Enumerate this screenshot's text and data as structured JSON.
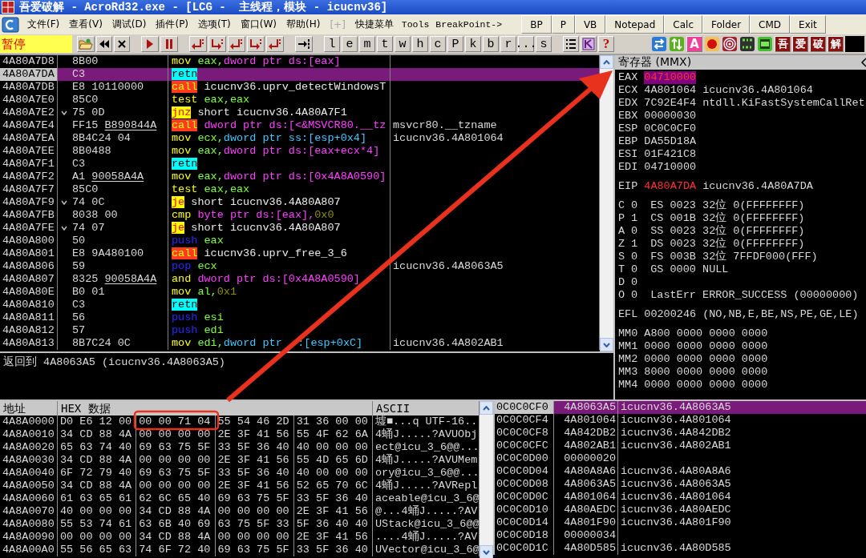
{
  "window": {
    "title": "吾爱破解 - AcroRd32.exe - [LCG -  主线程，模块 - icucnv36]"
  },
  "menu": [
    {
      "label": "文件(F)",
      "kind": "menu",
      "disabled": false
    },
    {
      "label": "查看(V)",
      "kind": "menu",
      "disabled": false
    },
    {
      "label": "调试(D)",
      "kind": "menu",
      "disabled": false
    },
    {
      "label": "插件(P)",
      "kind": "menu",
      "disabled": false
    },
    {
      "label": "选项(T)",
      "kind": "menu",
      "disabled": false
    },
    {
      "label": "窗口(W)",
      "kind": "menu",
      "disabled": false
    },
    {
      "label": "帮助(H)",
      "kind": "menu",
      "disabled": false
    },
    {
      "label": "[+]",
      "kind": "menu",
      "disabled": true
    },
    {
      "label": "快捷菜单",
      "kind": "menu",
      "disabled": false
    },
    {
      "label": "Tools",
      "kind": "script",
      "disabled": false
    },
    {
      "label": "BreakPoint->",
      "kind": "script",
      "disabled": false
    }
  ],
  "quick_buttons": [
    "BP",
    "P",
    "VB",
    "Notepad",
    "Calc",
    "Folder",
    "CMD",
    "Exit"
  ],
  "toolbar": {
    "status": "暂停",
    "letter_buttons": [
      "l",
      "e",
      "m",
      "t",
      "w",
      "h",
      "c",
      "P",
      "k",
      "b",
      "r",
      "...",
      "s"
    ],
    "help": "?",
    "ascii_button": "A",
    "brand_buttons": [
      "吾",
      "爱",
      "破",
      "解"
    ]
  },
  "disasm": {
    "rows": [
      {
        "address": "4A80A7D8",
        "jump": false,
        "selected": false,
        "hex": [
          {
            "text": "8B00",
            "underlined": false
          }
        ],
        "mnemonic": {
          "text": "mov",
          "kind": "move"
        },
        "operands": [
          {
            "text": "eax,",
            "kind": "reg"
          },
          {
            "text": "dword ptr ds:[eax]",
            "kind": "mem"
          }
        ]
      },
      {
        "address": "4A80A7DA",
        "jump": false,
        "selected": true,
        "hex": [
          {
            "text": "C3",
            "underlined": false
          }
        ],
        "mnemonic": {
          "text": "retn",
          "kind": "ret"
        },
        "operands": []
      },
      {
        "address": "4A80A7DB",
        "jump": false,
        "selected": false,
        "hex": [
          {
            "text": "E8",
            "underlined": false
          },
          {
            "text": "10110000",
            "underlined": false
          }
        ],
        "mnemonic": {
          "text": "call",
          "kind": "call"
        },
        "operands": [
          {
            "text": "icucnv36.uprv_detectWindowsT",
            "kind": "plain"
          }
        ]
      },
      {
        "address": "4A80A7E0",
        "jump": false,
        "selected": false,
        "hex": [
          {
            "text": "85C0",
            "underlined": false
          }
        ],
        "mnemonic": {
          "text": "test",
          "kind": "move"
        },
        "operands": [
          {
            "text": "eax,eax",
            "kind": "reg"
          }
        ]
      },
      {
        "address": "4A80A7E2",
        "jump": true,
        "selected": false,
        "hex": [
          {
            "text": "75",
            "underlined": false
          },
          {
            "text": "0D",
            "underlined": false
          }
        ],
        "mnemonic": {
          "text": "jnz",
          "kind": "jump"
        },
        "operands": [
          {
            "text": "short icucnv36.4A80A7F1",
            "kind": "plain"
          }
        ]
      },
      {
        "address": "4A80A7E4",
        "jump": false,
        "selected": false,
        "hex": [
          {
            "text": "FF15",
            "underlined": false
          },
          {
            "text": "B890844A",
            "underlined": true
          }
        ],
        "mnemonic": {
          "text": "call",
          "kind": "call"
        },
        "operands": [
          {
            "text": "dword ptr ds:[<&MSVCR80.__tz",
            "kind": "mem"
          }
        ],
        "comment": "msvcr80.__tzname"
      },
      {
        "address": "4A80A7EA",
        "jump": false,
        "selected": false,
        "hex": [
          {
            "text": "8B4C24",
            "underlined": false
          },
          {
            "text": "04",
            "underlined": false
          }
        ],
        "mnemonic": {
          "text": "mov",
          "kind": "move"
        },
        "operands": [
          {
            "text": "ecx,",
            "kind": "reg"
          },
          {
            "text": "dword ptr ss:[esp+0x4]",
            "kind": "stack_mem"
          }
        ],
        "comment": "icucnv36.4A801064"
      },
      {
        "address": "4A80A7EE",
        "jump": false,
        "selected": false,
        "hex": [
          {
            "text": "8B0488",
            "underlined": false
          }
        ],
        "mnemonic": {
          "text": "mov",
          "kind": "move"
        },
        "operands": [
          {
            "text": "eax,",
            "kind": "reg"
          },
          {
            "text": "dword ptr ds:[eax+ecx*4]",
            "kind": "mem"
          }
        ]
      },
      {
        "address": "4A80A7F1",
        "jump": false,
        "selected": false,
        "hex": [
          {
            "text": "C3",
            "underlined": false
          }
        ],
        "mnemonic": {
          "text": "retn",
          "kind": "ret"
        },
        "operands": []
      },
      {
        "address": "4A80A7F2",
        "jump": false,
        "selected": false,
        "hex": [
          {
            "text": "A1",
            "underlined": false
          },
          {
            "text": "90058A4A",
            "underlined": true
          }
        ],
        "mnemonic": {
          "text": "mov",
          "kind": "move"
        },
        "operands": [
          {
            "text": "eax,",
            "kind": "reg"
          },
          {
            "text": "dword ptr ds:[0x4A8A0590]",
            "kind": "mem"
          }
        ]
      },
      {
        "address": "4A80A7F7",
        "jump": false,
        "selected": false,
        "hex": [
          {
            "text": "85C0",
            "underlined": false
          }
        ],
        "mnemonic": {
          "text": "test",
          "kind": "move"
        },
        "operands": [
          {
            "text": "eax,eax",
            "kind": "reg"
          }
        ]
      },
      {
        "address": "4A80A7F9",
        "jump": true,
        "selected": false,
        "hex": [
          {
            "text": "74",
            "underlined": false
          },
          {
            "text": "0C",
            "underlined": false
          }
        ],
        "mnemonic": {
          "text": "je",
          "kind": "jump"
        },
        "operands": [
          {
            "text": "short icucnv36.4A80A807",
            "kind": "plain"
          }
        ]
      },
      {
        "address": "4A80A7FB",
        "jump": false,
        "selected": false,
        "hex": [
          {
            "text": "8038",
            "underlined": false
          },
          {
            "text": "00",
            "underlined": false
          }
        ],
        "mnemonic": {
          "text": "cmp",
          "kind": "move"
        },
        "operands": [
          {
            "text": "byte ptr ds:[eax],",
            "kind": "mem"
          },
          {
            "text": "0x0",
            "kind": "imm"
          }
        ]
      },
      {
        "address": "4A80A7FE",
        "jump": true,
        "selected": false,
        "hex": [
          {
            "text": "74",
            "underlined": false
          },
          {
            "text": "07",
            "underlined": false
          }
        ],
        "mnemonic": {
          "text": "je",
          "kind": "jump"
        },
        "operands": [
          {
            "text": "short icucnv36.4A80A807",
            "kind": "plain"
          }
        ]
      },
      {
        "address": "4A80A800",
        "jump": false,
        "selected": false,
        "hex": [
          {
            "text": "50",
            "underlined": false
          }
        ],
        "mnemonic": {
          "text": "push",
          "kind": "stack"
        },
        "operands": [
          {
            "text": "eax",
            "kind": "reg"
          }
        ]
      },
      {
        "address": "4A80A801",
        "jump": false,
        "selected": false,
        "hex": [
          {
            "text": "E8",
            "underlined": false
          },
          {
            "text": "9A480100",
            "underlined": false
          }
        ],
        "mnemonic": {
          "text": "call",
          "kind": "call"
        },
        "operands": [
          {
            "text": "icucnv36.uprv_free_3_6",
            "kind": "plain"
          }
        ]
      },
      {
        "address": "4A80A806",
        "jump": false,
        "selected": false,
        "hex": [
          {
            "text": "59",
            "underlined": false
          }
        ],
        "mnemonic": {
          "text": "pop",
          "kind": "stack"
        },
        "operands": [
          {
            "text": "ecx",
            "kind": "reg"
          }
        ],
        "comment": "icucnv36.4A8063A5"
      },
      {
        "address": "4A80A807",
        "jump": false,
        "selected": false,
        "hex": [
          {
            "text": "8325",
            "underlined": false
          },
          {
            "text": "90058A4A",
            "underlined": true
          }
        ],
        "mnemonic": {
          "text": "and",
          "kind": "move"
        },
        "operands": [
          {
            "text": "dword ptr ds:[0x4A8A0590]",
            "kind": "mem"
          }
        ]
      },
      {
        "address": "4A80A80E",
        "jump": false,
        "selected": false,
        "hex": [
          {
            "text": "B0",
            "underlined": false
          },
          {
            "text": "01",
            "underlined": false
          }
        ],
        "mnemonic": {
          "text": "mov",
          "kind": "move"
        },
        "operands": [
          {
            "text": "al,",
            "kind": "reg"
          },
          {
            "text": "0x1",
            "kind": "imm"
          }
        ]
      },
      {
        "address": "4A80A810",
        "jump": false,
        "selected": false,
        "hex": [
          {
            "text": "C3",
            "underlined": false
          }
        ],
        "mnemonic": {
          "text": "retn",
          "kind": "ret"
        },
        "operands": []
      },
      {
        "address": "4A80A811",
        "jump": false,
        "selected": false,
        "hex": [
          {
            "text": "56",
            "underlined": false
          }
        ],
        "mnemonic": {
          "text": "push",
          "kind": "stack"
        },
        "operands": [
          {
            "text": "esi",
            "kind": "reg"
          }
        ]
      },
      {
        "address": "4A80A812",
        "jump": false,
        "selected": false,
        "hex": [
          {
            "text": "57",
            "underlined": false
          }
        ],
        "mnemonic": {
          "text": "push",
          "kind": "stack"
        },
        "operands": [
          {
            "text": "edi",
            "kind": "reg"
          }
        ]
      },
      {
        "address": "4A80A813",
        "jump": false,
        "selected": false,
        "hex": [
          {
            "text": "8B7C24",
            "underlined": false
          },
          {
            "text": "0C",
            "underlined": false
          }
        ],
        "mnemonic": {
          "text": "mov",
          "kind": "move"
        },
        "operands": [
          {
            "text": "edi,",
            "kind": "reg"
          },
          {
            "text": "dword ptr",
            "kind": "stack_mem"
          },
          {
            "text": ":[esp+0xC]",
            "kind": "stack_mem_after_cover"
          }
        ],
        "comment": "icucnv36.4A802AB1"
      }
    ],
    "info_line": "返回到 4A8063A5 (icucnv36.4A8063A5)"
  },
  "registers": {
    "title": "寄存器 (MMX)",
    "general": [
      {
        "name": "EAX",
        "value": "04710000",
        "changed": true,
        "selected": true
      },
      {
        "name": "ECX",
        "value": "4A801064",
        "comment": "icucnv36.4A801064",
        "changed": false,
        "selected": false
      },
      {
        "name": "EDX",
        "value": "7C92E4F4",
        "comment": "ntdll.KiFastSystemCallRet",
        "changed": false,
        "selected": false
      },
      {
        "name": "EBX",
        "value": "00000030",
        "changed": false,
        "selected": false
      },
      {
        "name": "ESP",
        "value": "0C0C0CF0",
        "changed": false,
        "selected": false
      },
      {
        "name": "EBP",
        "value": "DA55D18A",
        "changed": false,
        "selected": false
      },
      {
        "name": "ESI",
        "value": "01F421C8",
        "changed": false,
        "selected": false
      },
      {
        "name": "EDI",
        "value": "04710000",
        "changed": false,
        "selected": false
      }
    ],
    "eip": {
      "name": "EIP",
      "value": "4A80A7DA",
      "comment": "icucnv36.4A80A7DA",
      "changed": true,
      "selected": false
    },
    "flags": [
      {
        "flag": "C",
        "value": "0",
        "segment": "ES 0023 32位 0(FFFFFFFF)"
      },
      {
        "flag": "P",
        "value": "1",
        "segment": "CS 001B 32位 0(FFFFFFFF)"
      },
      {
        "flag": "A",
        "value": "0",
        "segment": "SS 0023 32位 0(FFFFFFFF)"
      },
      {
        "flag": "Z",
        "value": "1",
        "segment": "DS 0023 32位 0(FFFFFFFF)"
      },
      {
        "flag": "S",
        "value": "0",
        "segment": "FS 003B 32位 7FFDF000(FFF)"
      },
      {
        "flag": "T",
        "value": "0",
        "segment": "GS 0000 NULL"
      },
      {
        "flag": "D",
        "value": "0"
      },
      {
        "flag": "O",
        "value": "0",
        "segment": "LastErr ERROR_SUCCESS (00000000)"
      }
    ],
    "efl": {
      "name": "EFL",
      "value": "00200246",
      "comment": "(NO,NB,E,BE,NS,PE,GE,LE)"
    },
    "mmx": [
      {
        "name": "MM0",
        "value": "A800 0000 0000 0000"
      },
      {
        "name": "MM1",
        "value": "0000 0000 0000 0000"
      },
      {
        "name": "MM2",
        "value": "0000 0000 0000 0000"
      },
      {
        "name": "MM3",
        "value": "8000 0000 0000 0000"
      },
      {
        "name": "MM4",
        "value": "0000 0000 0000 0000"
      }
    ]
  },
  "dump": {
    "columns": [
      "地址",
      "HEX 数据",
      "ASCII"
    ],
    "rows": [
      {
        "address": "4A8A0000",
        "groups": [
          "D0 E6 12 00",
          "00 00 71 04",
          "55 54 46 2D",
          "31 36 00 00"
        ],
        "ascii": "墟■...q UTF-16.."
      },
      {
        "address": "4A8A0010",
        "groups": [
          "34 CD 88 4A",
          "00 00 00 00",
          "2E 3F 41 56",
          "55 4F 62 6A"
        ],
        "ascii": "4蛹J.....?AVUObj"
      },
      {
        "address": "4A8A0020",
        "groups": [
          "65 63 74 40",
          "69 63 75 5F",
          "33 5F 36 40",
          "40 00 00 00"
        ],
        "ascii": "ect@icu_3_6@@..."
      },
      {
        "address": "4A8A0030",
        "groups": [
          "34 CD 88 4A",
          "00 00 00 00",
          "2E 3F 41 56",
          "55 4D 65 6D"
        ],
        "ascii": "4蛹J.....?AVUMem"
      },
      {
        "address": "4A8A0040",
        "groups": [
          "6F 72 79 40",
          "69 63 75 5F",
          "33 5F 36 40",
          "40 00 00 00"
        ],
        "ascii": "ory@icu_3_6@@..."
      },
      {
        "address": "4A8A0050",
        "groups": [
          "34 CD 88 4A",
          "00 00 00 00",
          "2E 3F 41 56",
          "52 65 70 6C"
        ],
        "ascii": "4蛹J.....?AVRepl"
      },
      {
        "address": "4A8A0060",
        "groups": [
          "61 63 65 61",
          "62 6C 65 40",
          "69 63 75 5F",
          "33 5F 36 40"
        ],
        "ascii": "aceable@icu_3_6@"
      },
      {
        "address": "4A8A0070",
        "groups": [
          "40 00 00 00",
          "34 CD 88 4A",
          "00 00 00 00",
          "2E 3F 41 56"
        ],
        "ascii": "@...4蛹J.....?AV"
      },
      {
        "address": "4A8A0080",
        "groups": [
          "55 53 74 61",
          "63 6B 40 69",
          "63 75 5F 33",
          "5F 36 40 40"
        ],
        "ascii": "UStack@icu_3_6@@"
      },
      {
        "address": "4A8A0090",
        "groups": [
          "00 00 00 00",
          "34 CD 88 4A",
          "00 00 00 00",
          "2E 3F 41 56"
        ],
        "ascii": "....4蛹J.....?AV"
      },
      {
        "address": "4A8A00A0",
        "groups": [
          "55 56 65 63",
          "74 6F 72 40",
          "69 63 75 5F",
          "33 5F 36 40"
        ],
        "ascii": "UVector@icu_3_6@"
      }
    ]
  },
  "stack": {
    "rows": [
      {
        "address": "0C0C0CF0",
        "value": "4A8063A5",
        "comment": "icucnv36.4A8063A5",
        "selected": true
      },
      {
        "address": "0C0C0CF4",
        "value": "4A801064",
        "comment": "icucnv36.4A801064",
        "selected": false
      },
      {
        "address": "0C0C0CF8",
        "value": "4A842DB2",
        "comment": "icucnv36.4A842DB2",
        "selected": false
      },
      {
        "address": "0C0C0CFC",
        "value": "4A802AB1",
        "comment": "icucnv36.4A802AB1",
        "selected": false
      },
      {
        "address": "0C0C0D00",
        "value": "00000020",
        "selected": false
      },
      {
        "address": "0C0C0D04",
        "value": "4A80A8A6",
        "comment": "icucnv36.4A80A8A6",
        "selected": false
      },
      {
        "address": "0C0C0D08",
        "value": "4A8063A5",
        "comment": "icucnv36.4A8063A5",
        "selected": false
      },
      {
        "address": "0C0C0D0C",
        "value": "4A801064",
        "comment": "icucnv36.4A801064",
        "selected": false
      },
      {
        "address": "0C0C0D10",
        "value": "4A80AEDC",
        "comment": "icucnv36.4A80AEDC",
        "selected": false
      },
      {
        "address": "0C0C0D14",
        "value": "4A801F90",
        "comment": "icucnv36.4A801F90",
        "selected": false
      },
      {
        "address": "0C0C0D18",
        "value": "00000034",
        "selected": false
      },
      {
        "address": "0C0C0D1C",
        "value": "4A80D585",
        "comment": "icucnv36.4A80D585",
        "selected": false
      }
    ]
  }
}
